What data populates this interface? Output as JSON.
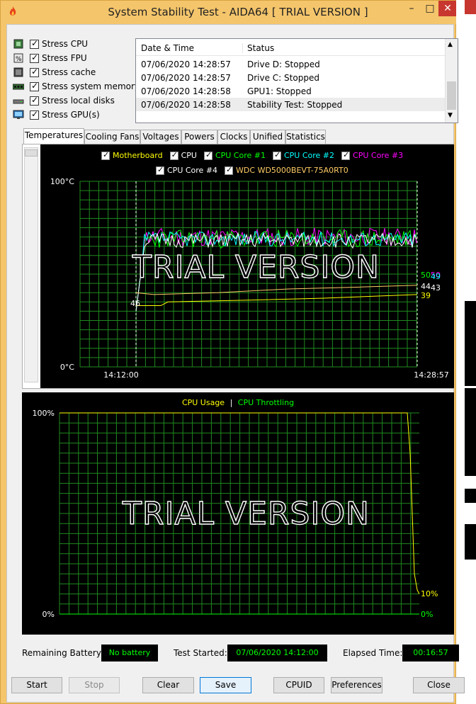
{
  "window": {
    "title": "System Stability Test - AIDA64  [ TRIAL VERSION ]",
    "minimize": "–",
    "maximize": "□",
    "close": "✕"
  },
  "stress": [
    {
      "label": "Stress CPU",
      "icon": "cpu-icon"
    },
    {
      "label": "Stress FPU",
      "icon": "fpu-icon"
    },
    {
      "label": "Stress cache",
      "icon": "cache-icon"
    },
    {
      "label": "Stress system memory",
      "icon": "memory-icon"
    },
    {
      "label": "Stress local disks",
      "icon": "disk-icon"
    },
    {
      "label": "Stress GPU(s)",
      "icon": "gpu-icon"
    }
  ],
  "log": {
    "col_date": "Date & Time",
    "col_status": "Status",
    "rows": [
      {
        "date": "07/06/2020 14:28:57",
        "status": "Drive D: Stopped"
      },
      {
        "date": "07/06/2020 14:28:57",
        "status": "Drive C: Stopped"
      },
      {
        "date": "07/06/2020 14:28:58",
        "status": "GPU1: Stopped"
      },
      {
        "date": "07/06/2020 14:28:58",
        "status": "Stability Test: Stopped"
      }
    ]
  },
  "tabs": [
    "Temperatures",
    "Cooling Fans",
    "Voltages",
    "Powers",
    "Clocks",
    "Unified",
    "Statistics"
  ],
  "temp_chart": {
    "legend_row1": [
      {
        "label": "Motherboard",
        "color": "#ffff00"
      },
      {
        "label": "CPU",
        "color": "#ffffff"
      },
      {
        "label": "CPU Core #1",
        "color": "#00ff00"
      },
      {
        "label": "CPU Core #2",
        "color": "#00ffff"
      },
      {
        "label": "CPU Core #3",
        "color": "#ff00ff"
      }
    ],
    "legend_row2": [
      {
        "label": "CPU Core #4",
        "color": "#ffffff"
      },
      {
        "label": "WDC WD5000BEVT-75A0RT0",
        "color": "#ffcc66"
      }
    ],
    "y_top": "100°C",
    "y_bottom": "0°C",
    "x_start": "14:12:00",
    "x_end": "14:28:57",
    "end_values": [
      {
        "text": "50",
        "color": "#00ff00"
      },
      {
        "text": "50",
        "color": "#ff00ff"
      },
      {
        "text": "49",
        "color": "#00ffff"
      },
      {
        "text": "44",
        "color": "#ffffff"
      },
      {
        "text": "43",
        "color": "#ffffff"
      },
      {
        "text": "39",
        "color": "#ffff00"
      }
    ],
    "watermark": "TRIAL VERSION",
    "marker": "46"
  },
  "usage_chart": {
    "legend_usage": "CPU Usage",
    "legend_sep": "|",
    "legend_throttle": "CPU Throttling",
    "usage_color": "#ffff00",
    "throttle_color": "#00ff00",
    "y_top": "100%",
    "y_bottom": "0%",
    "end_usage": "10%",
    "end_throttle": "0%",
    "watermark": "TRIAL VERSION"
  },
  "status": {
    "battery_label": "Remaining Battery:",
    "battery_value": "No battery",
    "started_label": "Test Started:",
    "started_value": "07/06/2020 14:12:00",
    "elapsed_label": "Elapsed Time:",
    "elapsed_value": "00:16:57"
  },
  "buttons": {
    "start": "Start",
    "stop": "Stop",
    "clear": "Clear",
    "save": "Save",
    "cpuid": "CPUID",
    "preferences": "Preferences",
    "close": "Close"
  }
}
